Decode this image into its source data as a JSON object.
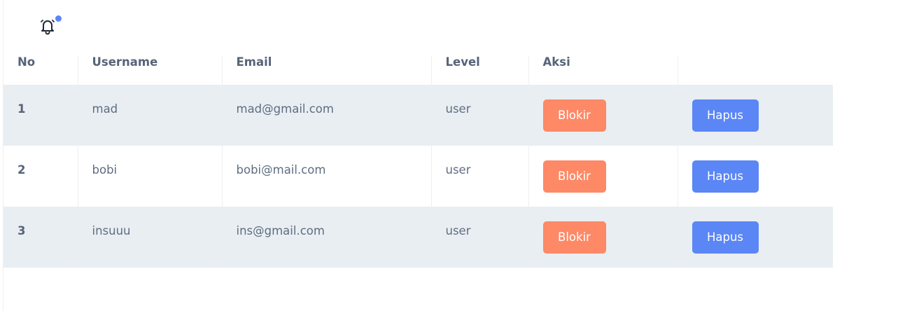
{
  "notification": {
    "icon": "bell-icon",
    "has_unread": true,
    "dot_color": "#5b86f5"
  },
  "table": {
    "headers": {
      "no": "No",
      "username": "Username",
      "email": "Email",
      "level": "Level",
      "aksi": "Aksi"
    },
    "rows": [
      {
        "no": "1",
        "username": "mad",
        "email": "mad@gmail.com",
        "level": "user",
        "block_label": "Blokir",
        "delete_label": "Hapus"
      },
      {
        "no": "2",
        "username": "bobi",
        "email": "bobi@mail.com",
        "level": "user",
        "block_label": "Blokir",
        "delete_label": "Hapus"
      },
      {
        "no": "3",
        "username": "insuuu",
        "email": "ins@gmail.com",
        "level": "user",
        "block_label": "Blokir",
        "delete_label": "Hapus"
      }
    ]
  },
  "colors": {
    "block_button": "#fd8967",
    "delete_button": "#5b86f5",
    "striped_row": "#e9eef2"
  }
}
